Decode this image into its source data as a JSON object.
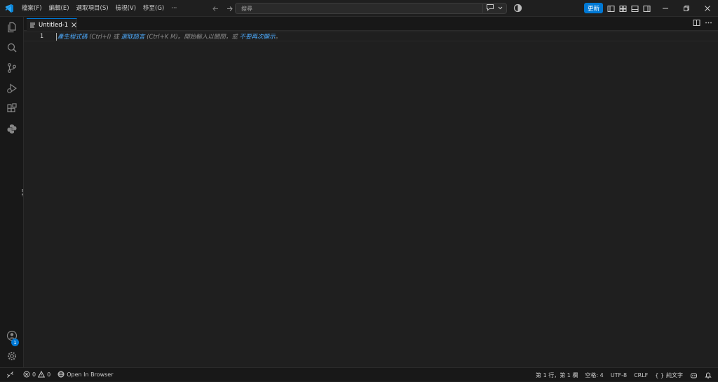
{
  "titlebar": {
    "menu": [
      "檔案(F)",
      "編輯(E)",
      "選取項目(S)",
      "檢視(V)",
      "移至(G)",
      "···"
    ],
    "search_placeholder": "搜尋",
    "update_label": "更新"
  },
  "colors": {
    "accent": "#0078d4",
    "link": "#4daafc",
    "background": "#1f1f1f"
  },
  "activity_bar": {
    "icons": [
      "explorer-icon",
      "search-icon",
      "source-control-icon",
      "run-debug-icon",
      "extensions-icon",
      "python-icon"
    ],
    "bottom_icons": [
      "account-icon",
      "manage-gear-icon"
    ],
    "manage_badge": "1"
  },
  "tabs": [
    {
      "label": "Untitled-1",
      "active": true
    }
  ],
  "editor": {
    "line_number": "1",
    "hint": {
      "generate": "產生程式碼",
      "generate_shortcut": " (Ctrl+I) 或 ",
      "select_language": "選取語言",
      "language_shortcut": " (Ctrl+K M)。開始輸入以關閉，或 ",
      "dont_show": "不要再次顯示",
      "end": "。"
    }
  },
  "statusbar": {
    "errors": "0",
    "warnings": "0",
    "open_in_browser": "Open In Browser",
    "position": "第 1 行，第 1 欄",
    "spaces": "空格: 4",
    "encoding": "UTF-8",
    "eol": "CRLF",
    "language": "純文字"
  }
}
